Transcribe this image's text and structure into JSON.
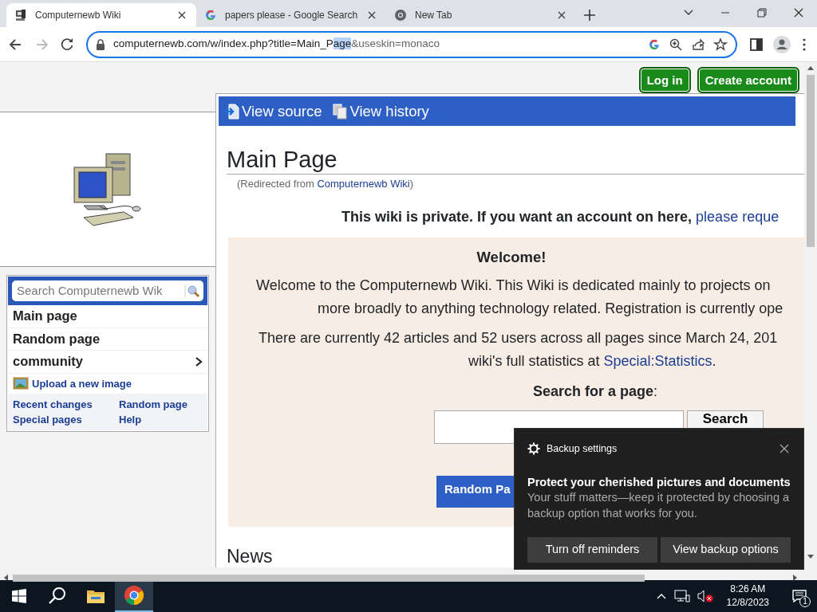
{
  "browser": {
    "tabs": [
      {
        "title": "Computernewb Wiki",
        "kind": "wiki",
        "selected": true
      },
      {
        "title": "papers please - Google Search",
        "kind": "google",
        "selected": false
      },
      {
        "title": "New Tab",
        "kind": "chrome",
        "selected": false
      }
    ],
    "nav": {
      "back_disabled": false,
      "forward_disabled": true
    },
    "url_parts": [
      {
        "text": "computernewb.com/w/index.php?title=Main_P",
        "selected": false
      },
      {
        "text": "age",
        "selected": true
      },
      {
        "text": "&useskin=monaco",
        "selected": false
      }
    ]
  },
  "page": {
    "auth_buttons": [
      "Log in",
      "Create account"
    ],
    "sidebar": {
      "search_placeholder": "Search Computernewb Wik",
      "items": [
        {
          "label": "Main page",
          "kind": "link"
        },
        {
          "label": "Random page",
          "kind": "link"
        },
        {
          "label": "community",
          "kind": "submenu"
        }
      ],
      "upload_link": "Upload a new image",
      "footer_links": [
        "Recent changes",
        "Random page",
        "Special pages",
        "Help"
      ]
    },
    "actions": [
      {
        "label": "View source",
        "kind": "source"
      },
      {
        "label": "View history",
        "kind": "history"
      }
    ],
    "title": "Main Page",
    "redirect": {
      "prefix": "(Redirected from ",
      "link": "Computernewb Wiki",
      "suffix": ")"
    },
    "notice": {
      "text": "This wiki is private. If you want an account on here, ",
      "link": "please reque"
    },
    "welcome": {
      "heading": "Welcome!",
      "lines": [
        "Welcome to the Computernewb Wiki. This Wiki is dedicated mainly to projects on",
        "more broadly to anything technology related. Registration is currently ope"
      ],
      "stats_line": "There are currently 42 articles and 52 users across all pages since March 24, 201",
      "stats_prefix": "wiki's full statistics at ",
      "stats_link": "Special:Statistics",
      "stats_suffix": ".",
      "search_label": "**Search for a page**:",
      "search_button": "Search",
      "random_button": "Random Pa"
    },
    "news_heading": "News"
  },
  "toast": {
    "app": "Backup settings",
    "heading": "Protect your cherished pictures and documents",
    "body": "Your stuff matters—keep it protected by choosing a backup option that works for you.",
    "buttons": [
      "Turn off reminders",
      "View backup options"
    ]
  },
  "taskbar": {
    "apps": [
      {
        "kind": "explorer",
        "active": false
      },
      {
        "kind": "chrome",
        "active": true
      }
    ],
    "time": "8:26 AM",
    "date": "12/8/2023",
    "notifications": "1"
  }
}
